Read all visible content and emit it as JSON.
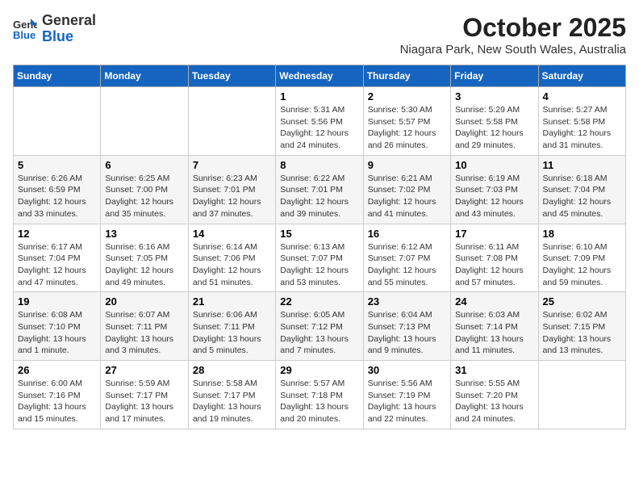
{
  "header": {
    "logo_general": "General",
    "logo_blue": "Blue",
    "month": "October 2025",
    "location": "Niagara Park, New South Wales, Australia"
  },
  "days_of_week": [
    "Sunday",
    "Monday",
    "Tuesday",
    "Wednesday",
    "Thursday",
    "Friday",
    "Saturday"
  ],
  "weeks": [
    [
      {
        "day": "",
        "info": ""
      },
      {
        "day": "",
        "info": ""
      },
      {
        "day": "",
        "info": ""
      },
      {
        "day": "1",
        "info": "Sunrise: 5:31 AM\nSunset: 5:56 PM\nDaylight: 12 hours\nand 24 minutes."
      },
      {
        "day": "2",
        "info": "Sunrise: 5:30 AM\nSunset: 5:57 PM\nDaylight: 12 hours\nand 26 minutes."
      },
      {
        "day": "3",
        "info": "Sunrise: 5:29 AM\nSunset: 5:58 PM\nDaylight: 12 hours\nand 29 minutes."
      },
      {
        "day": "4",
        "info": "Sunrise: 5:27 AM\nSunset: 5:58 PM\nDaylight: 12 hours\nand 31 minutes."
      }
    ],
    [
      {
        "day": "5",
        "info": "Sunrise: 6:26 AM\nSunset: 6:59 PM\nDaylight: 12 hours\nand 33 minutes."
      },
      {
        "day": "6",
        "info": "Sunrise: 6:25 AM\nSunset: 7:00 PM\nDaylight: 12 hours\nand 35 minutes."
      },
      {
        "day": "7",
        "info": "Sunrise: 6:23 AM\nSunset: 7:01 PM\nDaylight: 12 hours\nand 37 minutes."
      },
      {
        "day": "8",
        "info": "Sunrise: 6:22 AM\nSunset: 7:01 PM\nDaylight: 12 hours\nand 39 minutes."
      },
      {
        "day": "9",
        "info": "Sunrise: 6:21 AM\nSunset: 7:02 PM\nDaylight: 12 hours\nand 41 minutes."
      },
      {
        "day": "10",
        "info": "Sunrise: 6:19 AM\nSunset: 7:03 PM\nDaylight: 12 hours\nand 43 minutes."
      },
      {
        "day": "11",
        "info": "Sunrise: 6:18 AM\nSunset: 7:04 PM\nDaylight: 12 hours\nand 45 minutes."
      }
    ],
    [
      {
        "day": "12",
        "info": "Sunrise: 6:17 AM\nSunset: 7:04 PM\nDaylight: 12 hours\nand 47 minutes."
      },
      {
        "day": "13",
        "info": "Sunrise: 6:16 AM\nSunset: 7:05 PM\nDaylight: 12 hours\nand 49 minutes."
      },
      {
        "day": "14",
        "info": "Sunrise: 6:14 AM\nSunset: 7:06 PM\nDaylight: 12 hours\nand 51 minutes."
      },
      {
        "day": "15",
        "info": "Sunrise: 6:13 AM\nSunset: 7:07 PM\nDaylight: 12 hours\nand 53 minutes."
      },
      {
        "day": "16",
        "info": "Sunrise: 6:12 AM\nSunset: 7:07 PM\nDaylight: 12 hours\nand 55 minutes."
      },
      {
        "day": "17",
        "info": "Sunrise: 6:11 AM\nSunset: 7:08 PM\nDaylight: 12 hours\nand 57 minutes."
      },
      {
        "day": "18",
        "info": "Sunrise: 6:10 AM\nSunset: 7:09 PM\nDaylight: 12 hours\nand 59 minutes."
      }
    ],
    [
      {
        "day": "19",
        "info": "Sunrise: 6:08 AM\nSunset: 7:10 PM\nDaylight: 13 hours\nand 1 minute."
      },
      {
        "day": "20",
        "info": "Sunrise: 6:07 AM\nSunset: 7:11 PM\nDaylight: 13 hours\nand 3 minutes."
      },
      {
        "day": "21",
        "info": "Sunrise: 6:06 AM\nSunset: 7:11 PM\nDaylight: 13 hours\nand 5 minutes."
      },
      {
        "day": "22",
        "info": "Sunrise: 6:05 AM\nSunset: 7:12 PM\nDaylight: 13 hours\nand 7 minutes."
      },
      {
        "day": "23",
        "info": "Sunrise: 6:04 AM\nSunset: 7:13 PM\nDaylight: 13 hours\nand 9 minutes."
      },
      {
        "day": "24",
        "info": "Sunrise: 6:03 AM\nSunset: 7:14 PM\nDaylight: 13 hours\nand 11 minutes."
      },
      {
        "day": "25",
        "info": "Sunrise: 6:02 AM\nSunset: 7:15 PM\nDaylight: 13 hours\nand 13 minutes."
      }
    ],
    [
      {
        "day": "26",
        "info": "Sunrise: 6:00 AM\nSunset: 7:16 PM\nDaylight: 13 hours\nand 15 minutes."
      },
      {
        "day": "27",
        "info": "Sunrise: 5:59 AM\nSunset: 7:17 PM\nDaylight: 13 hours\nand 17 minutes."
      },
      {
        "day": "28",
        "info": "Sunrise: 5:58 AM\nSunset: 7:17 PM\nDaylight: 13 hours\nand 19 minutes."
      },
      {
        "day": "29",
        "info": "Sunrise: 5:57 AM\nSunset: 7:18 PM\nDaylight: 13 hours\nand 20 minutes."
      },
      {
        "day": "30",
        "info": "Sunrise: 5:56 AM\nSunset: 7:19 PM\nDaylight: 13 hours\nand 22 minutes."
      },
      {
        "day": "31",
        "info": "Sunrise: 5:55 AM\nSunset: 7:20 PM\nDaylight: 13 hours\nand 24 minutes."
      },
      {
        "day": "",
        "info": ""
      }
    ]
  ]
}
